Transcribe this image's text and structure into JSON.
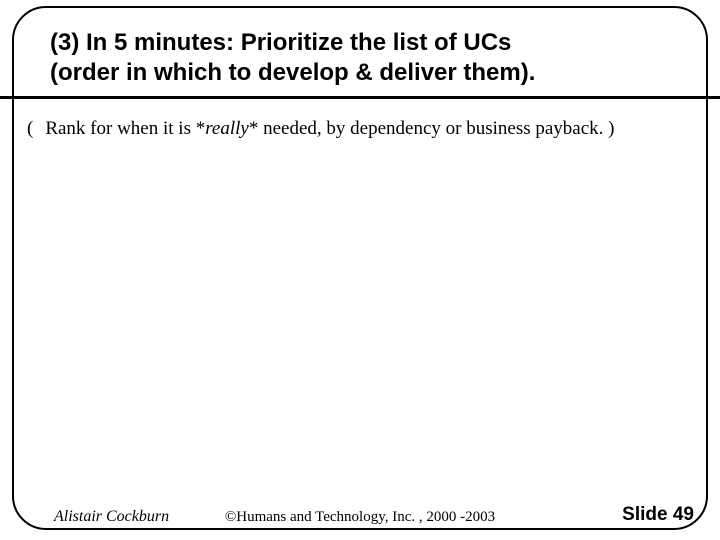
{
  "title": {
    "line1": "(3) In 5 minutes: Prioritize the list of UCs",
    "line2": "(order in which to develop & deliver them)."
  },
  "body": {
    "open_paren": "(",
    "pre": "Rank for when it is *",
    "emph": "really",
    "post": "* needed, by dependency or business payback. )"
  },
  "footer": {
    "author": "Alistair Cockburn",
    "copyright": "©Humans and Technology, Inc. , 2000 -2003",
    "slide_label": "Slide 49"
  }
}
